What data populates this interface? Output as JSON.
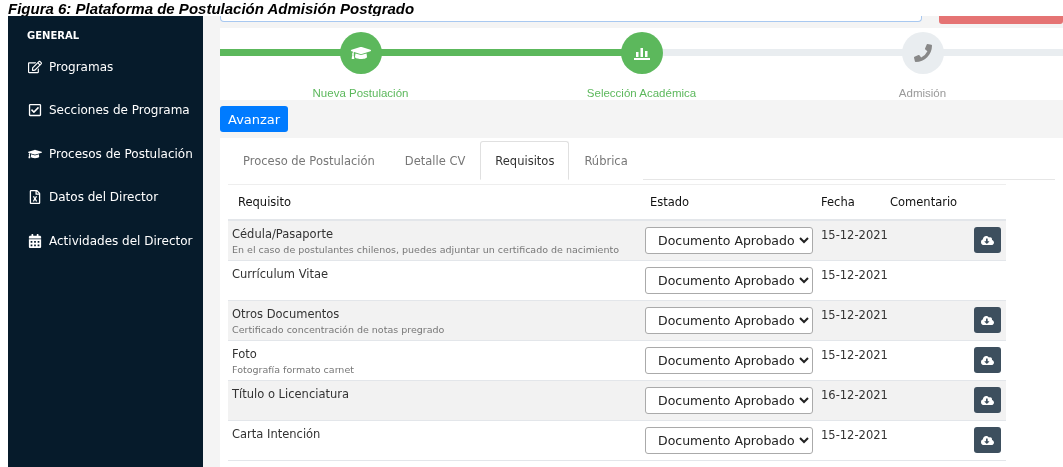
{
  "caption": "Figura 6: Plataforma de Postulación Admisión Postgrado",
  "sidebar": {
    "heading": "GENERAL",
    "items": [
      {
        "label": "Programas"
      },
      {
        "label": "Secciones de Programa"
      },
      {
        "label": "Procesos de Postulación"
      },
      {
        "label": "Datos del Director"
      },
      {
        "label": "Actividades del Director"
      }
    ]
  },
  "steps": [
    {
      "label": "Nueva Postulación",
      "done": true
    },
    {
      "label": "Selección Académica",
      "done": true
    },
    {
      "label": "Admisión",
      "done": false
    }
  ],
  "advance_button": "Avanzar",
  "tabs": [
    {
      "label": "Proceso de Postulación",
      "selected": false
    },
    {
      "label": "Detalle CV",
      "selected": false
    },
    {
      "label": "Requisitos",
      "selected": true
    },
    {
      "label": "Rúbrica",
      "selected": false
    }
  ],
  "table": {
    "columns": [
      "Requisito",
      "Estado",
      "Fecha",
      "Comentario"
    ],
    "rows": [
      {
        "requisito": "Cédula/Pasaporte",
        "note": "En el caso de postulantes chilenos, puedes adjuntar un certificado de nacimiento",
        "estado": "Documento Aprobado",
        "fecha": "15-12-2021",
        "download": true
      },
      {
        "requisito": "Currículum Vitae",
        "estado": "Documento Aprobado",
        "fecha": "15-12-2021",
        "download": false
      },
      {
        "requisito": "Otros Documentos",
        "note": "Certificado concentración de notas pregrado",
        "estado": "Documento Aprobado",
        "fecha": "15-12-2021",
        "download": true
      },
      {
        "requisito": "Foto",
        "note": "Fotografía formato carnet",
        "estado": "Documento Aprobado",
        "fecha": "15-12-2021",
        "download": true
      },
      {
        "requisito": "Título o Licenciatura",
        "estado": "Documento Aprobado",
        "fecha": "16-12-2021",
        "download": true
      },
      {
        "requisito": "Carta Intención",
        "estado": "Documento Aprobado",
        "fecha": "15-12-2021",
        "download": true
      }
    ]
  }
}
